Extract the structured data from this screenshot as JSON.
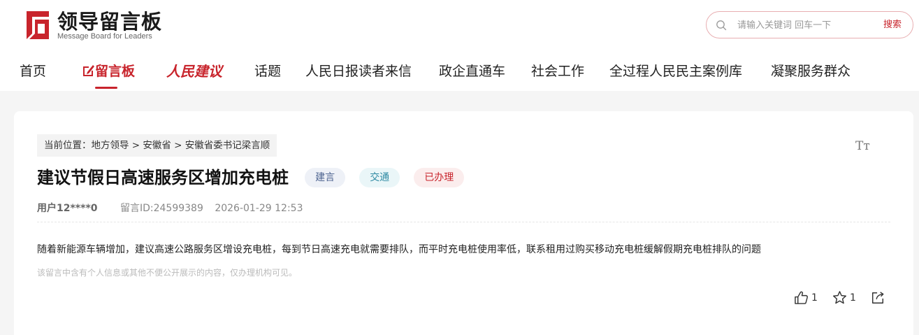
{
  "logo": {
    "cn": "领导留言板",
    "en": "Message Board for Leaders"
  },
  "search": {
    "placeholder": "请输入关键词 回车一下",
    "button": "搜索"
  },
  "nav": {
    "home": "首页",
    "board": "留言板",
    "suggest": "人民建议",
    "topics": "话题",
    "letters": "人民日报读者来信",
    "enterprise": "政企直通车",
    "social": "社会工作",
    "democracy": "全过程人民民主案例库",
    "service": "凝聚服务群众"
  },
  "post": {
    "breadcrumb": "当前位置：地方领导 > 安徽省 > 安徽省委书记梁言顺",
    "title": "建议节假日高速服务区增加充电桩",
    "tags": [
      "建言",
      "交通",
      "已办理"
    ],
    "user": "用户12****0",
    "id": "留言ID:24599389",
    "time": "2026-01-29 12:53",
    "content": "随着新能源车辆增加，建议高速公路服务区增设充电桩，每到节日高速充电就需要排队，而平时充电桩使用率低，联系租用过购买移动充电桩缓解假期充电桩排队的问题",
    "notice": "该留言中含有个人信息或其他不便公开展示的内容，仅办理机构可见。",
    "likes": "1",
    "favorites": "1"
  },
  "icons": {
    "text_size": "Tт",
    "search": "search-icon",
    "like": "thumbs-up-icon",
    "favorite": "star-icon",
    "share": "share-icon"
  },
  "colors": {
    "accent": "#c8242c"
  }
}
